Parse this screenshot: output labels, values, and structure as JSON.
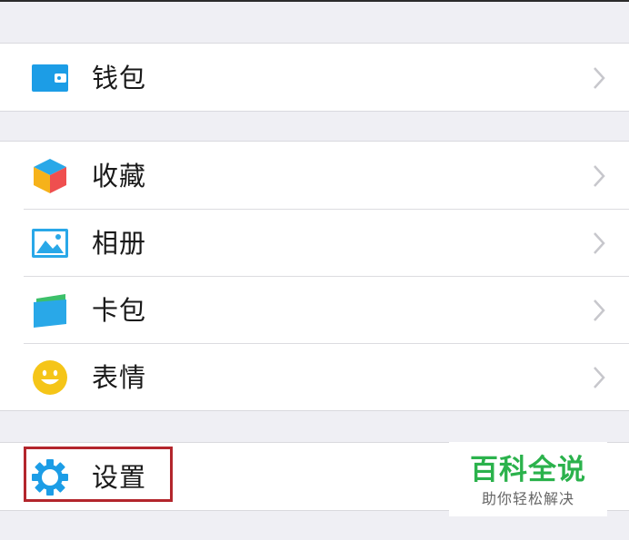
{
  "groups": [
    {
      "items": [
        {
          "label": "钱包",
          "icon": "wallet-icon",
          "icon_color": "#1c9de6"
        }
      ]
    },
    {
      "items": [
        {
          "label": "收藏",
          "icon": "favorites-cube-icon",
          "icon_color": "#f6b21a"
        },
        {
          "label": "相册",
          "icon": "album-icon",
          "icon_color": "#29a8e8"
        },
        {
          "label": "卡包",
          "icon": "card-package-icon",
          "icon_color": "#29a8e8"
        },
        {
          "label": "表情",
          "icon": "emoji-smiley-icon",
          "icon_color": "#f5c518"
        }
      ]
    },
    {
      "items": [
        {
          "label": "设置",
          "icon": "gear-icon",
          "icon_color": "#1c9de6"
        }
      ]
    }
  ],
  "watermark": {
    "title": "百科全说",
    "subtitle": "助你轻松解决",
    "color": "#2bb24c"
  },
  "highlight_color": "#b3262c",
  "background_color": "#efeff4"
}
